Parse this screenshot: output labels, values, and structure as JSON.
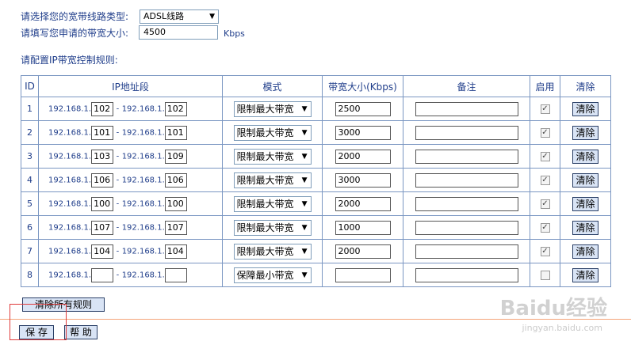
{
  "line_type": {
    "label": "请选择您的宽带线路类型:",
    "value": "ADSL线路"
  },
  "bandwidth": {
    "label": "请填写您申请的带宽大小:",
    "value": "4500",
    "unit": "Kbps"
  },
  "rules_title": "请配置IP带宽控制规则:",
  "table": {
    "headers": {
      "id": "ID",
      "ip": "IP地址段",
      "mode": "模式",
      "bw": "带宽大小(Kbps)",
      "note": "备注",
      "enable": "启用",
      "clear": "清除"
    },
    "ip_prefix": "192.168.1.",
    "separator": "-",
    "enabled_mark": "✓",
    "clear_label": "清除",
    "rows": [
      {
        "id": "1",
        "start": "102",
        "end": "102",
        "mode": "限制最大带宽",
        "bw": "2500",
        "note": "",
        "enabled": true
      },
      {
        "id": "2",
        "start": "101",
        "end": "101",
        "mode": "限制最大带宽",
        "bw": "3000",
        "note": "",
        "enabled": true
      },
      {
        "id": "3",
        "start": "103",
        "end": "109",
        "mode": "限制最大带宽",
        "bw": "2000",
        "note": "",
        "enabled": true
      },
      {
        "id": "4",
        "start": "106",
        "end": "106",
        "mode": "限制最大带宽",
        "bw": "3000",
        "note": "",
        "enabled": true
      },
      {
        "id": "5",
        "start": "100",
        "end": "100",
        "mode": "限制最大带宽",
        "bw": "2000",
        "note": "",
        "enabled": true
      },
      {
        "id": "6",
        "start": "107",
        "end": "107",
        "mode": "限制最大带宽",
        "bw": "1000",
        "note": "",
        "enabled": true
      },
      {
        "id": "7",
        "start": "104",
        "end": "104",
        "mode": "限制最大带宽",
        "bw": "2000",
        "note": "",
        "enabled": true
      },
      {
        "id": "8",
        "start": "",
        "end": "",
        "mode": "保障最小带宽",
        "bw": "",
        "note": "",
        "enabled": false
      }
    ]
  },
  "buttons": {
    "clear_all": "清除所有规则",
    "save": "保 存",
    "help": "帮 助"
  },
  "watermark": {
    "main": "Baidu经验",
    "sub": "jingyan.baidu.com"
  }
}
